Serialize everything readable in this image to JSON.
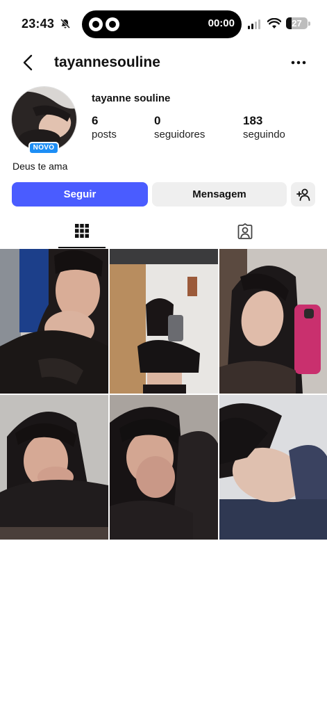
{
  "status_bar": {
    "time": "23:43",
    "timer": "00:00",
    "battery": "27",
    "battery_level": 0.27
  },
  "header": {
    "username": "tayannesouline"
  },
  "profile": {
    "full_name": "tayanne souline",
    "badge": "NOVO",
    "bio": "Deus te ama",
    "stats": [
      {
        "value": "6",
        "label": "posts"
      },
      {
        "value": "0",
        "label": "seguidores"
      },
      {
        "value": "183",
        "label": "seguindo"
      }
    ]
  },
  "actions": {
    "follow": "Seguir",
    "message": "Mensagem"
  },
  "colors": {
    "follow_button": "#4a5cff",
    "secondary_button": "#efefef",
    "badge": "#1d8ef5"
  },
  "posts": [
    {
      "icon": "photo-post-1"
    },
    {
      "icon": "photo-post-2"
    },
    {
      "icon": "photo-post-3"
    },
    {
      "icon": "photo-post-4"
    },
    {
      "icon": "photo-post-5"
    },
    {
      "icon": "photo-post-6"
    }
  ]
}
